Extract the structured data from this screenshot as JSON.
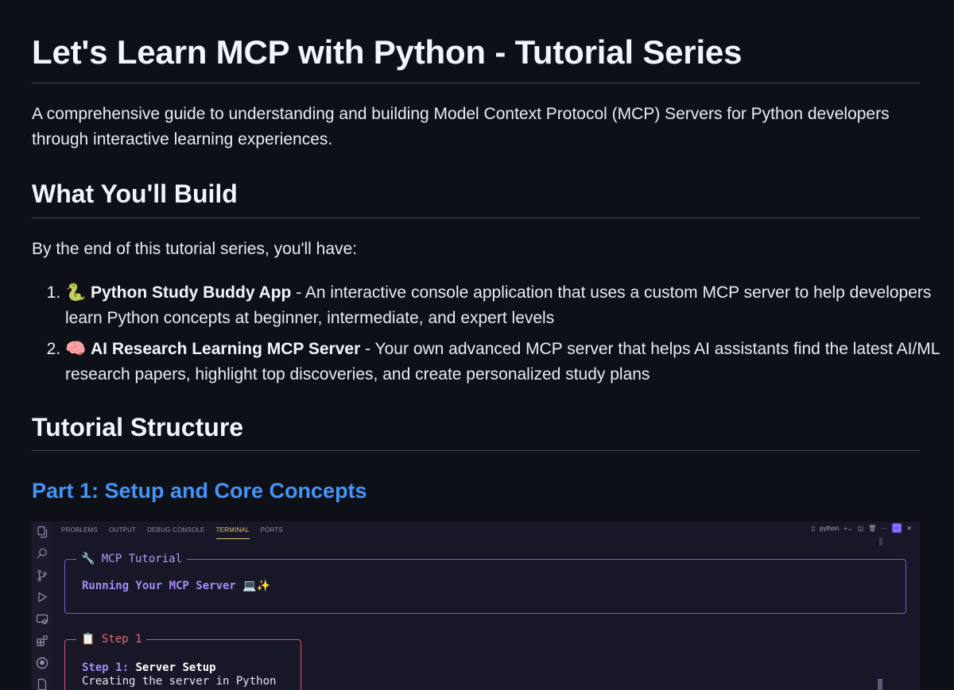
{
  "doc": {
    "title": "Let's Learn MCP with Python - Tutorial Series",
    "intro": "A comprehensive guide to understanding and building Model Context Protocol (MCP) Servers for Python developers through interactive learning experiences.",
    "build_heading": "What You'll Build",
    "build_lead": "By the end of this tutorial series, you'll have:",
    "build_items": [
      {
        "emoji": "🐍",
        "name": "Python Study Buddy App",
        "desc": " - An interactive console application that uses a custom MCP server to help developers learn Python concepts at beginner, intermediate, and expert levels"
      },
      {
        "emoji": "🧠",
        "name": "AI Research Learning MCP Server",
        "desc": " - Your own advanced MCP server that helps AI assistants find the latest AI/ML research papers, highlight top discoveries, and create personalized study plans"
      }
    ],
    "structure_heading": "Tutorial Structure",
    "part1_heading": "Part 1: Setup and Core Concepts"
  },
  "ide": {
    "activity_icons": [
      "explorer-icon",
      "search-icon",
      "source-control-icon",
      "run-debug-icon",
      "remote-explorer-icon",
      "extensions-icon",
      "github-icon",
      "file-icon"
    ],
    "tabs": [
      "PROBLEMS",
      "OUTPUT",
      "DEBUG CONSOLE",
      "TERMINAL",
      "PORTS"
    ],
    "active_tab": "TERMINAL",
    "terminal_name": "python",
    "box1": {
      "title": "🔧 MCP Tutorial",
      "line": "Running Your MCP Server 💻✨"
    },
    "box2": {
      "title": "📋 Step 1",
      "step_label": "Step 1:",
      "step_title": "Server Setup",
      "detail": "Creating the server in Python"
    }
  }
}
